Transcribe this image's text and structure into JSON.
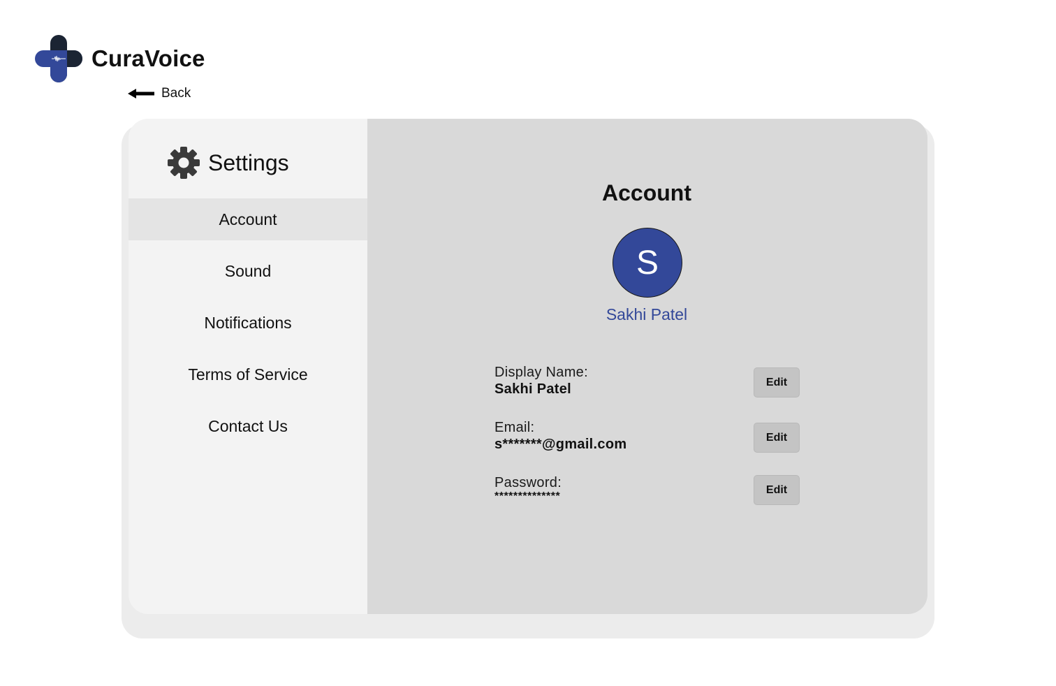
{
  "app": {
    "name": "CuraVoice",
    "brand_blue": "#334899",
    "brand_dark": "#1b2433"
  },
  "nav_back": {
    "label": "Back",
    "icon": "arrow-left-icon"
  },
  "sidebar": {
    "title": "Settings",
    "icon": "gear-icon",
    "items": [
      {
        "label": "Account",
        "active": true
      },
      {
        "label": "Sound",
        "active": false
      },
      {
        "label": "Notifications",
        "active": false
      },
      {
        "label": "Terms of Service",
        "active": false
      },
      {
        "label": "Contact Us",
        "active": false
      }
    ]
  },
  "account": {
    "title": "Account",
    "avatar_initial": "S",
    "profile_name": "Sakhi Patel",
    "fields": [
      {
        "label": "Display Name:",
        "value": "Sakhi Patel",
        "button": "Edit"
      },
      {
        "label": "Email:",
        "value": "s*******@gmail.com",
        "button": "Edit"
      },
      {
        "label": "Password:",
        "value": "**************",
        "button": "Edit"
      }
    ]
  }
}
